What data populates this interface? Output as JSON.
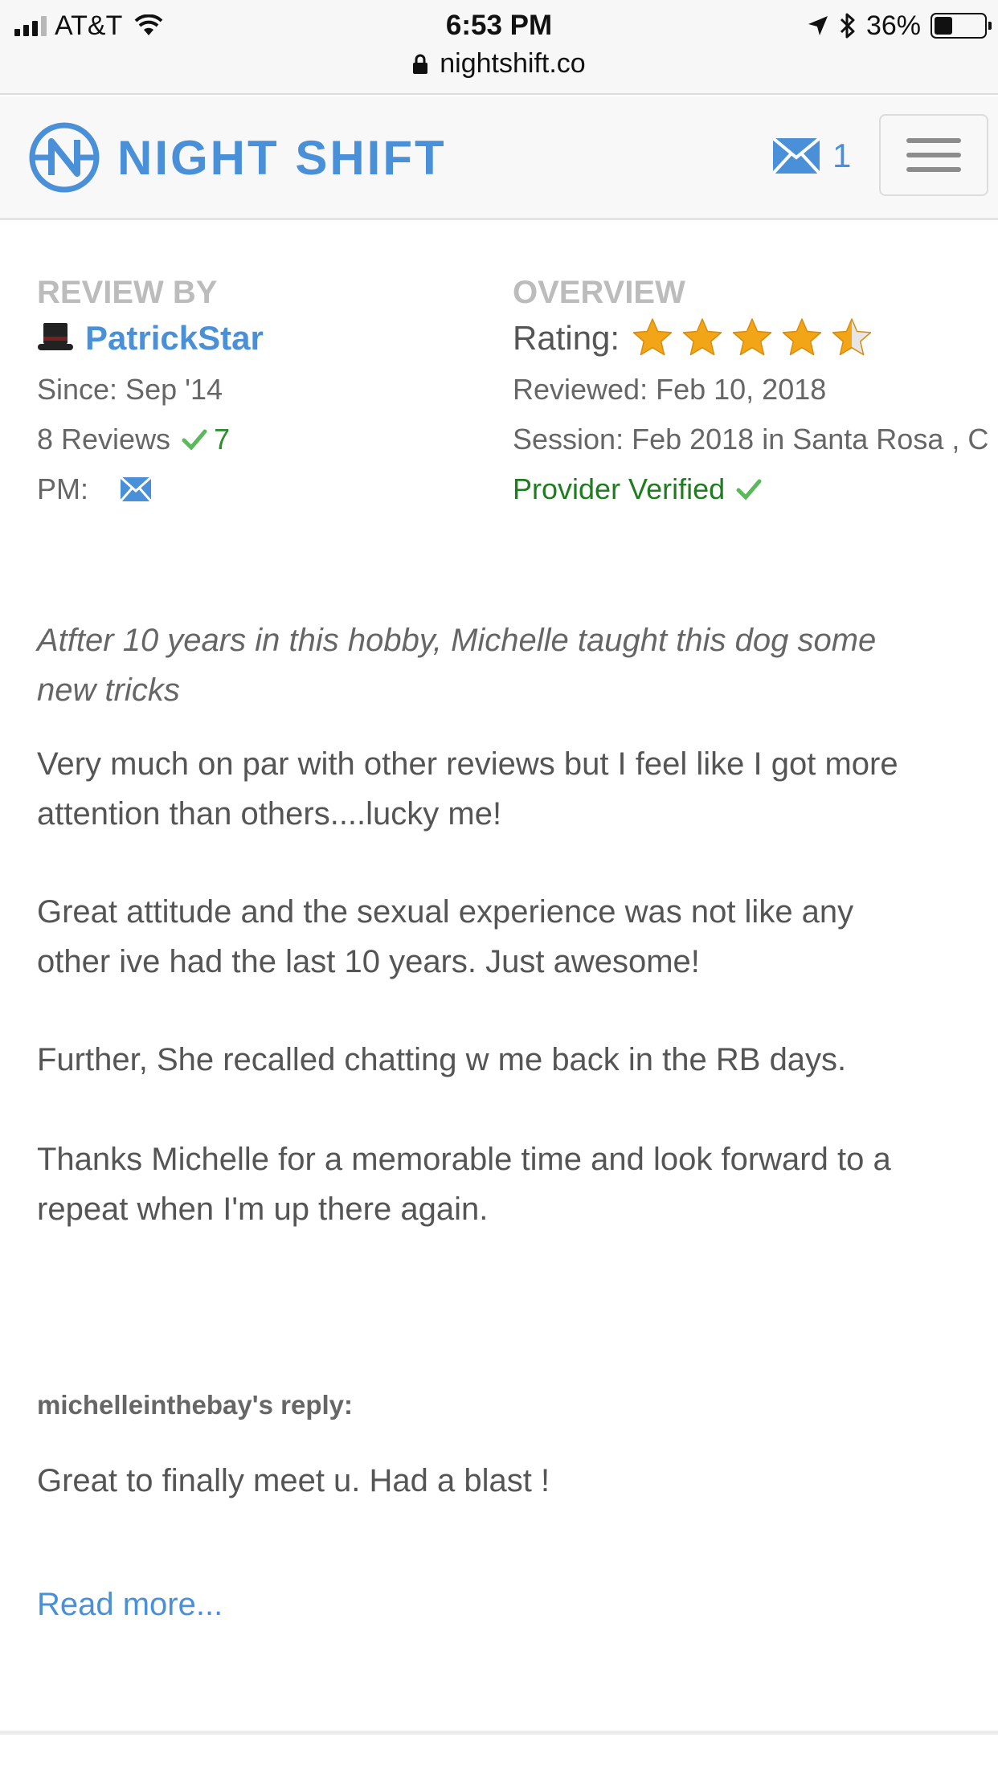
{
  "status_bar": {
    "carrier": "AT&T",
    "time": "6:53 PM",
    "battery_percent": "36%",
    "battery_level": 0.36,
    "url": "nightshift.co"
  },
  "header": {
    "logo_text": "NIGHT SHIFT",
    "message_count": "1",
    "brand_color": "#4a90d9"
  },
  "review_by": {
    "heading": "REVIEW BY",
    "username": "PatrickStar",
    "since": "Since: Sep '14",
    "reviews_label": "8 Reviews",
    "verified_count": "7",
    "pm_label": "PM:"
  },
  "overview": {
    "heading": "OVERVIEW",
    "rating_label": "Rating:",
    "rating": 4.5,
    "rating_max": 5,
    "reviewed": "Reviewed: Feb 10, 2018",
    "session": "Session: Feb 2018 in Santa Rosa , C",
    "provider_verified": "Provider Verified"
  },
  "review": {
    "title_line1": "Atfter 10 years in this hobby, Michelle taught this dog some",
    "title_line2": "new tricks",
    "paragraphs": [
      [
        "Very much on par with other reviews but I feel like I got more",
        "attention than others....lucky me!"
      ],
      [
        "Great attitude and the sexual experience was not like any",
        "other ive had the last 10 years.  Just awesome!"
      ],
      [
        "Further, She recalled chatting w me back in the RB days."
      ],
      [
        "Thanks Michelle for a memorable time and look forward to a",
        "repeat when I'm up there again."
      ]
    ]
  },
  "reply": {
    "label": "michelleinthebay's reply:",
    "text": "Great to finally meet u. Had a blast !"
  },
  "read_more": "Read more..."
}
